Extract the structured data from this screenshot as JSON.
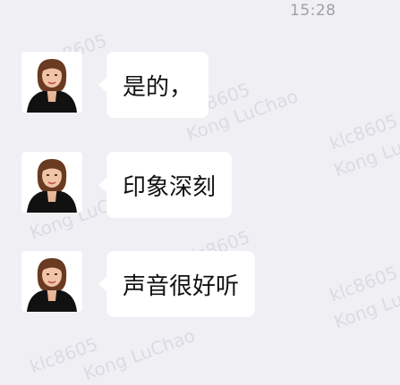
{
  "timestamp": "15:28",
  "messages": [
    {
      "text": "是的，"
    },
    {
      "text": "印象深刻"
    },
    {
      "text": "声音很好听"
    }
  ],
  "watermark": {
    "line1": "klc8605",
    "line2": "Kong LuChao"
  }
}
